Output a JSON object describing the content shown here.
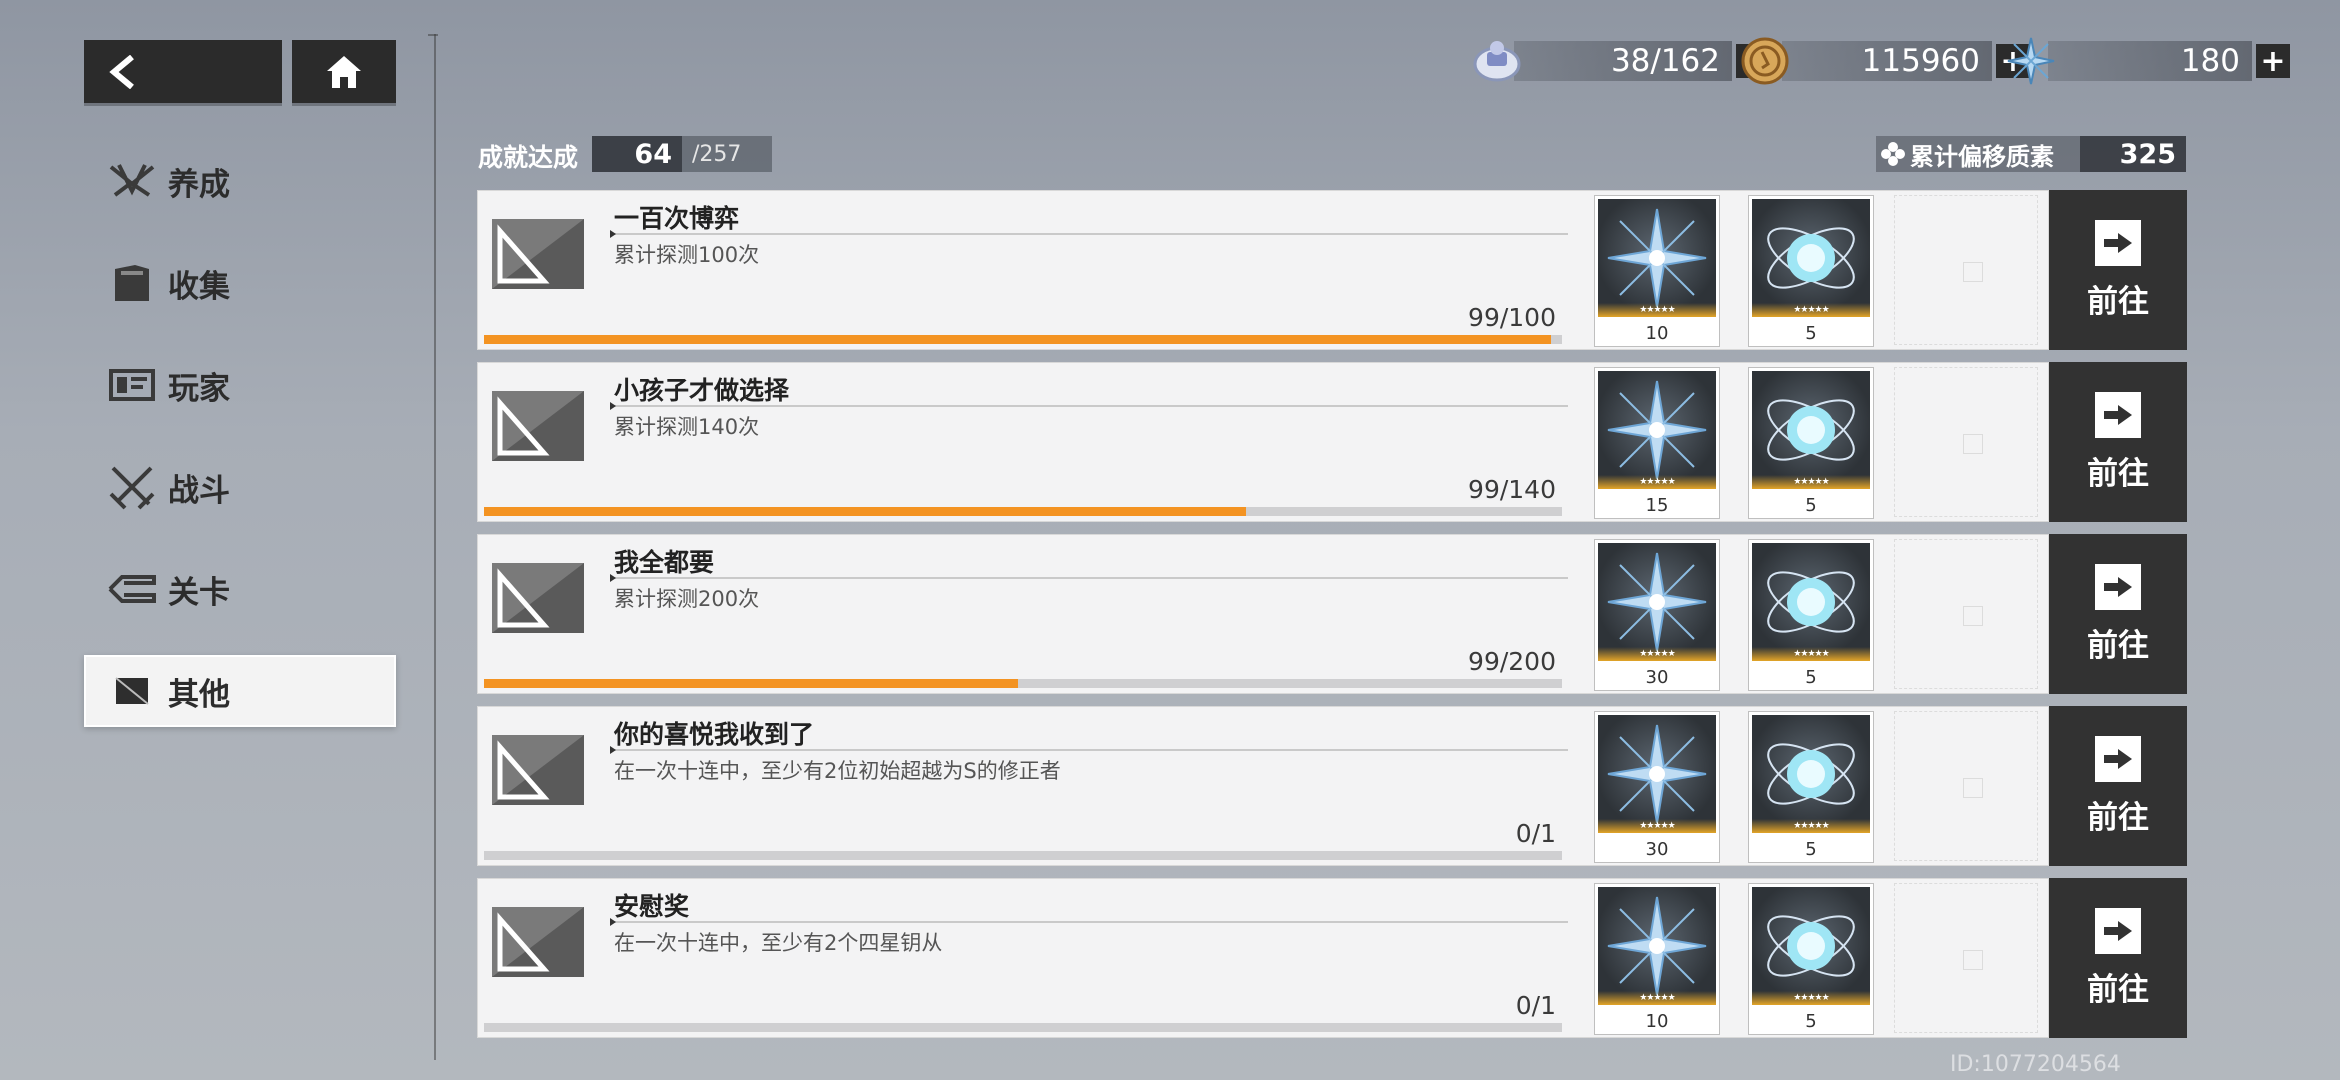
{
  "nav": {
    "back_icon": "back-arrow-icon",
    "home_icon": "home-icon"
  },
  "resources": [
    {
      "icon": "stamina-icon",
      "value": "38/162"
    },
    {
      "icon": "coin-icon",
      "value": "115960"
    },
    {
      "icon": "crystal-icon",
      "value": "180"
    }
  ],
  "sidebar": {
    "items": [
      {
        "label": "养成",
        "icon": "wings-icon"
      },
      {
        "label": "收集",
        "icon": "book-icon"
      },
      {
        "label": "玩家",
        "icon": "id-card-icon"
      },
      {
        "label": "战斗",
        "icon": "crossed-swords-icon"
      },
      {
        "label": "关卡",
        "icon": "flag-icon"
      },
      {
        "label": "其他",
        "icon": "square-icon",
        "active": true
      }
    ]
  },
  "summary": {
    "label": "成就达成",
    "done": "64",
    "total": "/257",
    "offset_label": "累计偏移质素",
    "offset_value": "325"
  },
  "achievements": [
    {
      "title": "一百次博弈",
      "desc": "累计探测100次",
      "progress_text": "99/100",
      "progress": 0.99,
      "reward1_qty": "10",
      "reward2_qty": "5",
      "go_label": "前往"
    },
    {
      "title": "小孩子才做选择",
      "desc": "累计探测140次",
      "progress_text": "99/140",
      "progress": 0.707,
      "reward1_qty": "15",
      "reward2_qty": "5",
      "go_label": "前往"
    },
    {
      "title": "我全都要",
      "desc": "累计探测200次",
      "progress_text": "99/200",
      "progress": 0.495,
      "reward1_qty": "30",
      "reward2_qty": "5",
      "go_label": "前往"
    },
    {
      "title": "你的喜悦我收到了",
      "desc": "在一次十连中，至少有2位初始超越为S的修正者",
      "progress_text": "0/1",
      "progress": 0,
      "reward1_qty": "30",
      "reward2_qty": "5",
      "go_label": "前往"
    },
    {
      "title": "安慰奖",
      "desc": "在一次十连中，至少有2个四星钥从",
      "progress_text": "0/1",
      "progress": 0,
      "reward1_qty": "10",
      "reward2_qty": "5",
      "go_label": "前往"
    }
  ],
  "reward_stars": "★★★★★",
  "uid": "ID:1077204564",
  "colors": {
    "progress": "#f39322",
    "dark": "#2b2b2b"
  }
}
